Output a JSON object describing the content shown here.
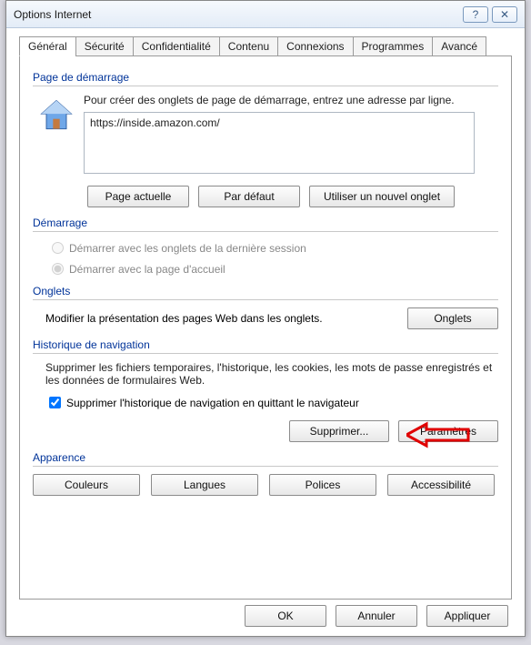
{
  "window": {
    "title": "Options Internet"
  },
  "titlebar": {
    "help": "?",
    "close": "✕"
  },
  "tabs": [
    {
      "label": "Général"
    },
    {
      "label": "Sécurité"
    },
    {
      "label": "Confidentialité"
    },
    {
      "label": "Contenu"
    },
    {
      "label": "Connexions"
    },
    {
      "label": "Programmes"
    },
    {
      "label": "Avancé"
    }
  ],
  "homepage": {
    "group": "Page de démarrage",
    "text": "Pour créer des onglets de page de démarrage, entrez une adresse par ligne.",
    "url": "https://inside.amazon.com/",
    "btn_current": "Page actuelle",
    "btn_default": "Par défaut",
    "btn_newtab": "Utiliser un nouvel onglet"
  },
  "startup": {
    "group": "Démarrage",
    "opt_last": "Démarrer avec les onglets de la dernière session",
    "opt_home": "Démarrer avec la page d'accueil"
  },
  "tabs_section": {
    "group": "Onglets",
    "text": "Modifier la présentation des pages Web dans les onglets.",
    "btn": "Onglets"
  },
  "history": {
    "group": "Historique de navigation",
    "text": "Supprimer les fichiers temporaires, l'historique, les cookies, les mots de passe enregistrés et les données de formulaires Web.",
    "chk": "Supprimer l'historique de navigation en quittant le navigateur",
    "btn_delete": "Supprimer...",
    "btn_params": "Paramètres"
  },
  "appearance": {
    "group": "Apparence",
    "btn_colors": "Couleurs",
    "btn_langs": "Langues",
    "btn_fonts": "Polices",
    "btn_access": "Accessibilité"
  },
  "footer": {
    "ok": "OK",
    "cancel": "Annuler",
    "apply": "Appliquer"
  }
}
